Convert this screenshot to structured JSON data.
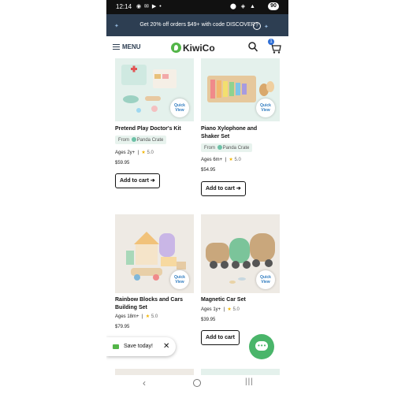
{
  "status_bar": {
    "time": "12:14",
    "battery": "90"
  },
  "promo": {
    "text": "Get 20% off orders $49+ with code DISCOVER",
    "help": "?"
  },
  "header": {
    "menu_label": "MENU",
    "logo_text": "KiwiCo",
    "cart_count": "1"
  },
  "products": [
    {
      "title_line1": "Pretend Play Doctor's Kit",
      "title_line2": "",
      "from_label": "From",
      "crate": "Panda Crate",
      "ages": "Ages 2y+",
      "rating": "5.0",
      "price": "$59.95",
      "cta": "Add to cart",
      "quick_view_line1": "Quick",
      "quick_view_line2": "View"
    },
    {
      "title_line1": "Piano Xylophone and",
      "title_line2": "Shaker Set",
      "from_label": "From",
      "crate": "Panda Crate",
      "ages": "Ages 6m+",
      "rating": "5.0",
      "price": "$54.95",
      "cta": "Add to cart",
      "quick_view_line1": "Quick",
      "quick_view_line2": "View"
    },
    {
      "title_line1": "Rainbow Blocks and Cars",
      "title_line2": "Building Set",
      "ages": "Ages 18m+",
      "rating": "5.0",
      "price": "$79.95",
      "quick_view_line1": "Quick",
      "quick_view_line2": "View"
    },
    {
      "title_line1": "Magnetic Car Set",
      "title_line2": "",
      "ages": "Ages 1y+",
      "rating": "5.0",
      "price": "$39.95",
      "cta": "Add to cart",
      "quick_view_line1": "Quick",
      "quick_view_line2": "View"
    }
  ],
  "save_prompt": {
    "text": "Save today!",
    "close": "✕"
  },
  "nav": {
    "back": "‹",
    "recent": "|||"
  },
  "colors": {
    "banner": "#2d3e52",
    "brand_green": "#53b548",
    "chat_green": "#4ab56a",
    "star": "#f2b400"
  },
  "icons": [
    "search-icon",
    "cart-icon",
    "menu-icon",
    "chat-icon",
    "close-icon",
    "mail-icon"
  ]
}
